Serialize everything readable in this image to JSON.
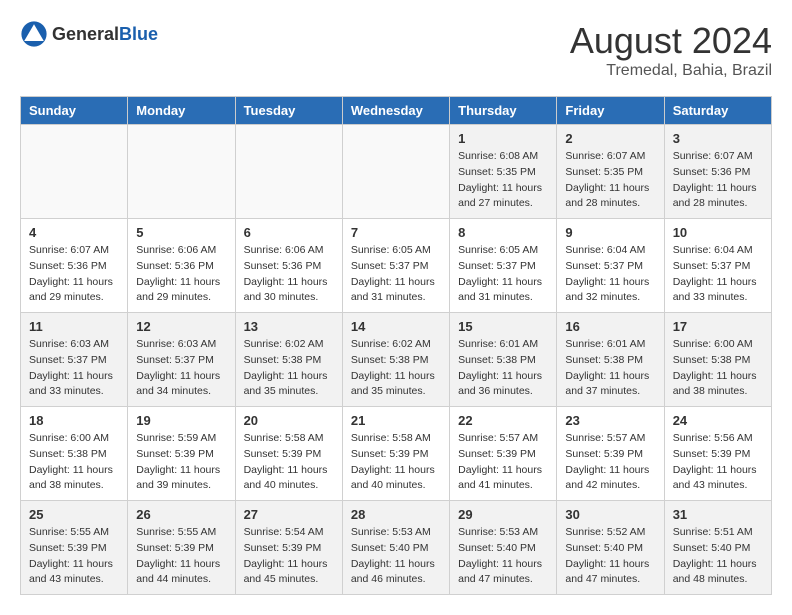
{
  "header": {
    "logo_general": "General",
    "logo_blue": "Blue",
    "month_year": "August 2024",
    "location": "Tremedal, Bahia, Brazil"
  },
  "days_of_week": [
    "Sunday",
    "Monday",
    "Tuesday",
    "Wednesday",
    "Thursday",
    "Friday",
    "Saturday"
  ],
  "weeks": [
    [
      {
        "day": "",
        "empty": true
      },
      {
        "day": "",
        "empty": true
      },
      {
        "day": "",
        "empty": true
      },
      {
        "day": "",
        "empty": true
      },
      {
        "day": "1",
        "sunrise": "6:08 AM",
        "sunset": "5:35 PM",
        "daylight": "11 hours and 27 minutes."
      },
      {
        "day": "2",
        "sunrise": "6:07 AM",
        "sunset": "5:35 PM",
        "daylight": "11 hours and 28 minutes."
      },
      {
        "day": "3",
        "sunrise": "6:07 AM",
        "sunset": "5:36 PM",
        "daylight": "11 hours and 28 minutes."
      }
    ],
    [
      {
        "day": "4",
        "sunrise": "6:07 AM",
        "sunset": "5:36 PM",
        "daylight": "11 hours and 29 minutes."
      },
      {
        "day": "5",
        "sunrise": "6:06 AM",
        "sunset": "5:36 PM",
        "daylight": "11 hours and 29 minutes."
      },
      {
        "day": "6",
        "sunrise": "6:06 AM",
        "sunset": "5:36 PM",
        "daylight": "11 hours and 30 minutes."
      },
      {
        "day": "7",
        "sunrise": "6:05 AM",
        "sunset": "5:37 PM",
        "daylight": "11 hours and 31 minutes."
      },
      {
        "day": "8",
        "sunrise": "6:05 AM",
        "sunset": "5:37 PM",
        "daylight": "11 hours and 31 minutes."
      },
      {
        "day": "9",
        "sunrise": "6:04 AM",
        "sunset": "5:37 PM",
        "daylight": "11 hours and 32 minutes."
      },
      {
        "day": "10",
        "sunrise": "6:04 AM",
        "sunset": "5:37 PM",
        "daylight": "11 hours and 33 minutes."
      }
    ],
    [
      {
        "day": "11",
        "sunrise": "6:03 AM",
        "sunset": "5:37 PM",
        "daylight": "11 hours and 33 minutes."
      },
      {
        "day": "12",
        "sunrise": "6:03 AM",
        "sunset": "5:37 PM",
        "daylight": "11 hours and 34 minutes."
      },
      {
        "day": "13",
        "sunrise": "6:02 AM",
        "sunset": "5:38 PM",
        "daylight": "11 hours and 35 minutes."
      },
      {
        "day": "14",
        "sunrise": "6:02 AM",
        "sunset": "5:38 PM",
        "daylight": "11 hours and 35 minutes."
      },
      {
        "day": "15",
        "sunrise": "6:01 AM",
        "sunset": "5:38 PM",
        "daylight": "11 hours and 36 minutes."
      },
      {
        "day": "16",
        "sunrise": "6:01 AM",
        "sunset": "5:38 PM",
        "daylight": "11 hours and 37 minutes."
      },
      {
        "day": "17",
        "sunrise": "6:00 AM",
        "sunset": "5:38 PM",
        "daylight": "11 hours and 38 minutes."
      }
    ],
    [
      {
        "day": "18",
        "sunrise": "6:00 AM",
        "sunset": "5:38 PM",
        "daylight": "11 hours and 38 minutes."
      },
      {
        "day": "19",
        "sunrise": "5:59 AM",
        "sunset": "5:39 PM",
        "daylight": "11 hours and 39 minutes."
      },
      {
        "day": "20",
        "sunrise": "5:58 AM",
        "sunset": "5:39 PM",
        "daylight": "11 hours and 40 minutes."
      },
      {
        "day": "21",
        "sunrise": "5:58 AM",
        "sunset": "5:39 PM",
        "daylight": "11 hours and 40 minutes."
      },
      {
        "day": "22",
        "sunrise": "5:57 AM",
        "sunset": "5:39 PM",
        "daylight": "11 hours and 41 minutes."
      },
      {
        "day": "23",
        "sunrise": "5:57 AM",
        "sunset": "5:39 PM",
        "daylight": "11 hours and 42 minutes."
      },
      {
        "day": "24",
        "sunrise": "5:56 AM",
        "sunset": "5:39 PM",
        "daylight": "11 hours and 43 minutes."
      }
    ],
    [
      {
        "day": "25",
        "sunrise": "5:55 AM",
        "sunset": "5:39 PM",
        "daylight": "11 hours and 43 minutes."
      },
      {
        "day": "26",
        "sunrise": "5:55 AM",
        "sunset": "5:39 PM",
        "daylight": "11 hours and 44 minutes."
      },
      {
        "day": "27",
        "sunrise": "5:54 AM",
        "sunset": "5:39 PM",
        "daylight": "11 hours and 45 minutes."
      },
      {
        "day": "28",
        "sunrise": "5:53 AM",
        "sunset": "5:40 PM",
        "daylight": "11 hours and 46 minutes."
      },
      {
        "day": "29",
        "sunrise": "5:53 AM",
        "sunset": "5:40 PM",
        "daylight": "11 hours and 47 minutes."
      },
      {
        "day": "30",
        "sunrise": "5:52 AM",
        "sunset": "5:40 PM",
        "daylight": "11 hours and 47 minutes."
      },
      {
        "day": "31",
        "sunrise": "5:51 AM",
        "sunset": "5:40 PM",
        "daylight": "11 hours and 48 minutes."
      }
    ]
  ]
}
